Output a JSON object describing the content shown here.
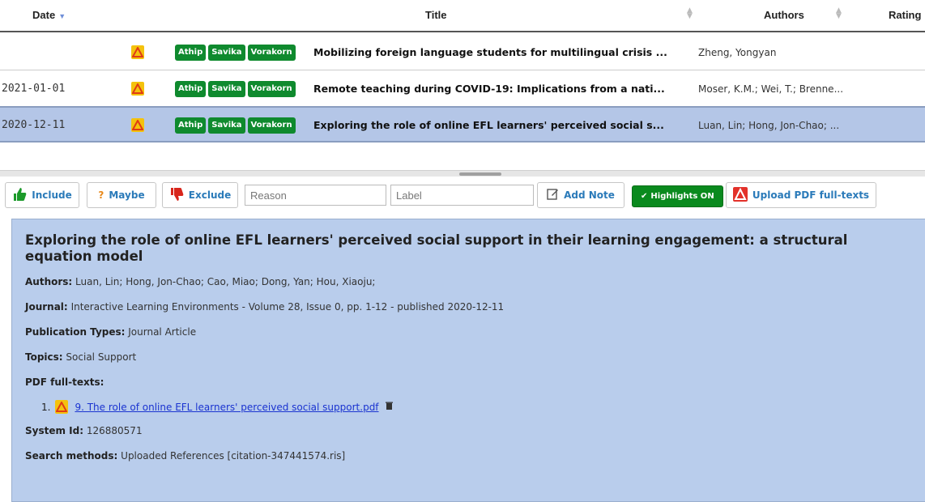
{
  "table": {
    "columns": {
      "date": "Date",
      "title": "Title",
      "authors": "Authors",
      "rating": "Rating"
    },
    "rows": [
      {
        "date": "",
        "tags": [
          "Athip",
          "Savika",
          "Vorakorn"
        ],
        "title": "Mobilizing foreign language students for multilingual crisis ...",
        "authors": "Zheng, Yongyan",
        "selected": false
      },
      {
        "date": "2021-01-01",
        "tags": [
          "Athip",
          "Savika",
          "Vorakorn"
        ],
        "title": "Remote teaching during COVID-19: Implications from a nati...",
        "authors": "Moser, K.M.; Wei, T.; Brenne...",
        "selected": false
      },
      {
        "date": "2020-12-11",
        "tags": [
          "Athip",
          "Savika",
          "Vorakorn"
        ],
        "title": "Exploring the role of online EFL learners' perceived social s...",
        "authors": "Luan, Lin; Hong, Jon-Chao; ...",
        "selected": true
      }
    ]
  },
  "toolbar": {
    "include": "Include",
    "maybe": "Maybe",
    "exclude": "Exclude",
    "reason_placeholder": "Reason",
    "label_placeholder": "Label",
    "add_note": "Add Note",
    "highlights": "Highlights ON",
    "upload_pdf": "Upload PDF full-texts"
  },
  "detail": {
    "title": "Exploring the role of online EFL learners' perceived social support in their learning engagement: a structural equation model",
    "authors_label": "Authors:",
    "authors": "Luan, Lin; Hong, Jon-Chao; Cao, Miao; Dong, Yan; Hou, Xiaoju;",
    "journal_label": "Journal:",
    "journal": "Interactive Learning Environments - Volume 28, Issue 0, pp. 1-12 - published 2020-12-11",
    "pubtype_label": "Publication Types:",
    "pubtype": "Journal Article",
    "topics_label": "Topics:",
    "topics": "Social Support",
    "pdf_label": "PDF full-texts:",
    "pdf_index": "1.",
    "pdf_file": "9. The role of online EFL learners' perceived social support.pdf",
    "sysid_label": "System Id:",
    "sysid": "126880571",
    "search_label": "Search methods:",
    "search": "Uploaded References [citation-347441574.ris]"
  },
  "colors": {
    "tag_green": "#0f8a2e",
    "selected_row": "#b4c6e7",
    "detail_bg": "#b9cdec",
    "link_blue": "#1a33d0",
    "button_text": "#2a7ab9",
    "pdf_yellow": "#f4c20d"
  },
  "icons": {
    "pdf": "pdf-icon",
    "include": "thumbs-up-icon",
    "maybe": "question-icon",
    "exclude": "thumbs-down-icon",
    "note": "edit-note-icon",
    "check": "check-icon",
    "upload": "pdf-upload-icon",
    "trash": "trash-icon"
  }
}
